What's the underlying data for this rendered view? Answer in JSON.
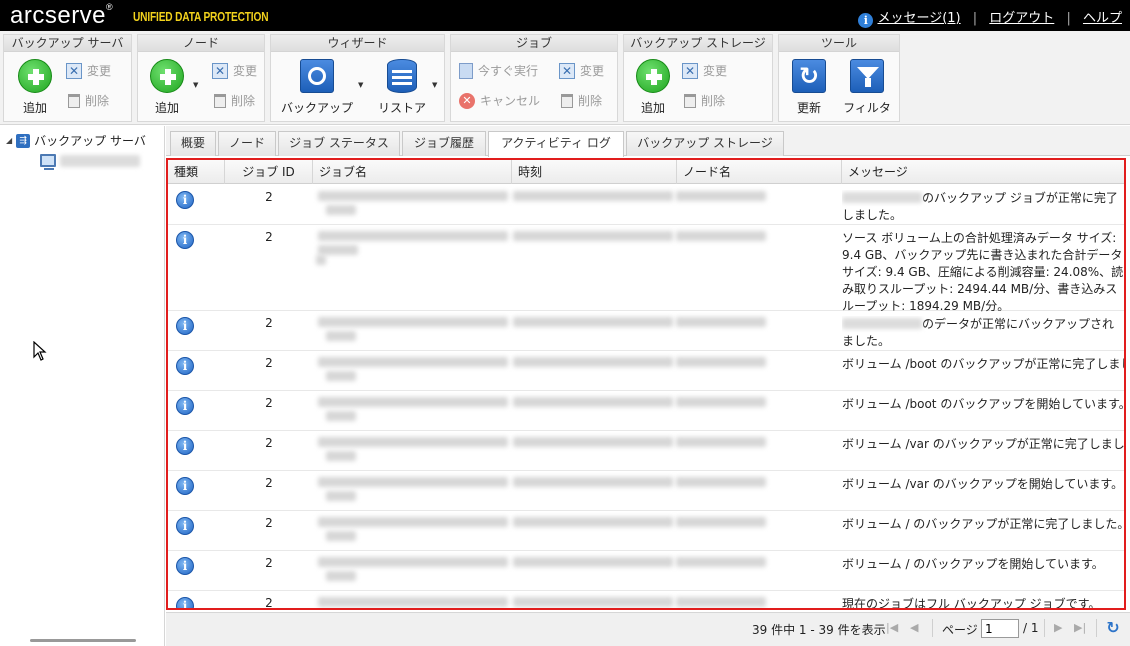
{
  "header": {
    "brand": "arcserve",
    "brand_mark": "®",
    "product": "UNIFIED DATA PROTECTION",
    "messages_link": "メッセージ(1)",
    "logout_link": "ログアウト",
    "help_link": "ヘルプ",
    "info_glyph": "i",
    "separator": "|"
  },
  "toolbar": {
    "backup_server": {
      "title": "バックアップ サーバ",
      "add": "追加",
      "edit": "変更",
      "delete": "削除"
    },
    "node": {
      "title": "ノード",
      "add": "追加",
      "edit": "変更",
      "delete": "削除"
    },
    "wizard": {
      "title": "ウィザード",
      "backup": "バックアップ",
      "restore": "リストア"
    },
    "job": {
      "title": "ジョブ",
      "run_now": "今すぐ実行",
      "edit": "変更",
      "cancel": "キャンセル",
      "delete": "削除"
    },
    "storage": {
      "title": "バックアップ ストレージ",
      "add": "追加",
      "edit": "変更",
      "delete": "削除"
    },
    "tools": {
      "title": "ツール",
      "refresh": "更新",
      "filter": "フィルタ"
    }
  },
  "tree": {
    "root_label": "バックアップ サーバ",
    "toggle": "◢"
  },
  "tabs": [
    {
      "label": "概要"
    },
    {
      "label": "ノード"
    },
    {
      "label": "ジョブ ステータス"
    },
    {
      "label": "ジョブ履歴"
    },
    {
      "label": "アクティビティ ログ",
      "active": true
    },
    {
      "label": "バックアップ ストレージ"
    }
  ],
  "grid": {
    "columns": [
      "種類",
      "ジョブ ID",
      "ジョブ名",
      "時刻",
      "ノード名",
      "メッセージ"
    ],
    "rows": [
      {
        "type_icon": "info-icon",
        "job_id": "2",
        "message": "のバックアップ ジョブが正常に完了しました。"
      },
      {
        "type_icon": "info-icon",
        "job_id": "2",
        "message": "ソース ボリューム上の合計処理済みデータ サイズ: 9.4 GB、バックアップ先に書き込まれた合計データ サイズ: 9.4 GB、圧縮による削減容量: 24.08%、読み取りスループット: 2494.44 MB/分、書き込みスループット: 1894.29 MB/分。"
      },
      {
        "type_icon": "info-icon",
        "job_id": "2",
        "message": "のデータが正常にバックアップされました。"
      },
      {
        "type_icon": "info-icon",
        "job_id": "2",
        "message": "ボリューム /boot のバックアップが正常に完了しました。"
      },
      {
        "type_icon": "info-icon",
        "job_id": "2",
        "message": "ボリューム /boot のバックアップを開始しています。"
      },
      {
        "type_icon": "info-icon",
        "job_id": "2",
        "message": "ボリューム /var のバックアップが正常に完了しました。"
      },
      {
        "type_icon": "info-icon",
        "job_id": "2",
        "message": "ボリューム /var のバックアップを開始しています。"
      },
      {
        "type_icon": "info-icon",
        "job_id": "2",
        "message": "ボリューム / のバックアップが正常に完了しました。"
      },
      {
        "type_icon": "info-icon",
        "job_id": "2",
        "message": "ボリューム / のバックアップを開始しています。"
      },
      {
        "type_icon": "info-icon",
        "job_id": "2",
        "message": "現在のジョブはフル バックアップ ジョブです。"
      }
    ]
  },
  "pager": {
    "summary": "39 件中 1 - 39 件を表示",
    "page_label": "ページ",
    "current_page": "1",
    "total_pages": "/ 1"
  }
}
